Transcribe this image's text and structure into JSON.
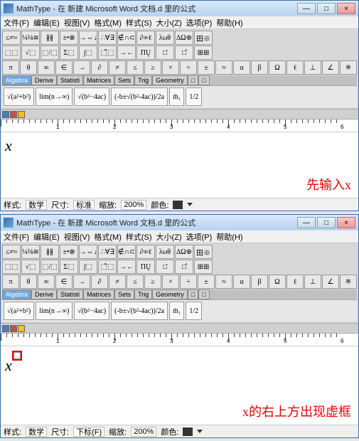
{
  "title": "MathType - 在 新建 Microsoft Word 文档.d 里的公式",
  "menu": {
    "file": "文件(F)",
    "edit": "编辑(E)",
    "view": "视图(V)",
    "format": "格式(M)",
    "style": "样式(S)",
    "size": "大小(Z)",
    "option": "选项(P)",
    "help": "帮助(H)"
  },
  "palette_row1": [
    "≤≠≈",
    "¼⅛≅",
    "∦∦",
    "±•⊗",
    "→⇔↓",
    "∴∀∃",
    "∉∩⊂",
    "∂∞ℓ",
    "λωθ",
    "∆Ω⊕",
    "田※"
  ],
  "palette_row2": [
    "⬚⬚",
    "√⬚",
    "⬚/⬚",
    "Σ⬚",
    "∫⬚",
    "⬚̄⬚",
    "→←",
    "ΠŲ",
    "□̇",
    "□̂",
    "⊞⊞"
  ],
  "palette_row3": [
    "π",
    "θ",
    "∞",
    "∈",
    "→",
    "∂",
    "≠",
    "≤",
    "≥",
    "×",
    "÷",
    "±",
    "≈",
    "α",
    "β",
    "Ω",
    "ℓ",
    "⊥",
    "∠",
    "※"
  ],
  "tabs": {
    "algebra": "Algebra",
    "derive": "Derive",
    "statist": "Statisti",
    "matrices": "Matrices",
    "sets": "Sets",
    "trig": "Trig",
    "geometry": "Geometry",
    "tab8": "□",
    "tab9": "□"
  },
  "examples": [
    "√(a²+b²)",
    "lim(n→∞)",
    "√(b²−4ac)",
    "(-b±√(b²-4ac))/2a",
    "m̄₁",
    "1/2"
  ],
  "ruler_nums": [
    "1",
    "2",
    "3",
    "4",
    "5",
    "6"
  ],
  "edit_content": "x",
  "annotation1": "先输入x",
  "annotation2": "x的右上方出现虚框",
  "status": {
    "style": "样式:",
    "math": "数学",
    "size": "尺寸:",
    "sizeval": "标准",
    "zoomlbl": "缩放:",
    "zoom": "200%",
    "color": "颜色:",
    "cursor1": "下标(F)"
  }
}
